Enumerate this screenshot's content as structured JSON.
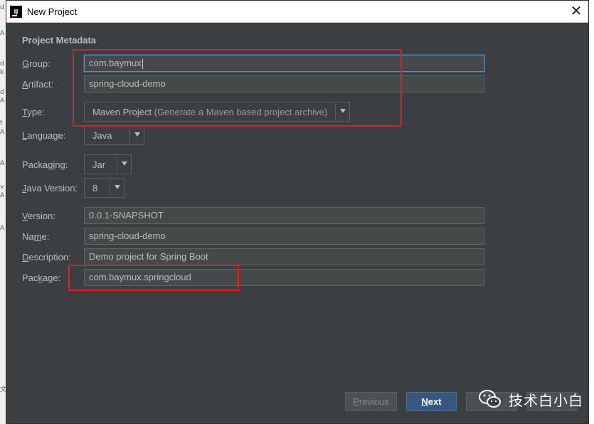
{
  "window": {
    "title": "New Project",
    "close_glyph": "✕",
    "app_icon_letter": "IJ"
  },
  "section_title": "Project Metadata",
  "fields": {
    "group": {
      "label_mnemonic": "G",
      "label_rest": "roup:",
      "value": "com.baymux"
    },
    "artifact": {
      "label_mnemonic": "A",
      "label_rest": "rtifact:",
      "value": "spring-cloud-demo"
    },
    "type": {
      "label_mnemonic": "T",
      "label_rest": "ype:",
      "value": "Maven Project",
      "hint": " (Generate a Maven based project archive)"
    },
    "language": {
      "label_mnemonic": "L",
      "label_rest": "anguage:",
      "value": "Java"
    },
    "packaging": {
      "label_pre": "Packag",
      "label_mnemonic": "i",
      "label_rest": "ng:",
      "value": "Jar"
    },
    "java_version": {
      "label_mnemonic": "J",
      "label_rest": "ava Version:",
      "value": "8"
    },
    "version": {
      "label_mnemonic": "V",
      "label_rest": "ersion:",
      "value": "0.0.1-SNAPSHOT"
    },
    "name": {
      "label_pre": "Na",
      "label_mnemonic": "m",
      "label_rest": "e:",
      "value": "spring-cloud-demo"
    },
    "description": {
      "label_mnemonic": "D",
      "label_rest": "escription:",
      "value": "Demo project for Spring Boot"
    },
    "package": {
      "label_pre": "Pac",
      "label_mnemonic": "k",
      "label_rest": "age:",
      "value": "com.baymux.springcloud"
    }
  },
  "buttons": {
    "previous": {
      "mnemonic": "P",
      "rest": "revious"
    },
    "next": {
      "mnemonic": "N",
      "rest": "ext"
    }
  },
  "watermark": {
    "text": "技术白小白",
    "icon": "wechat-icon"
  },
  "background_chars": [
    "d",
    "A",
    "d",
    "k",
    "d",
    "A",
    "t",
    "A",
    "A",
    "v",
    "A",
    "A",
    "文"
  ],
  "colors": {
    "dialog_bg": "#3c3f41",
    "field_bg": "#45494a",
    "highlight_red": "#e02020",
    "primary_button": "#365880"
  }
}
